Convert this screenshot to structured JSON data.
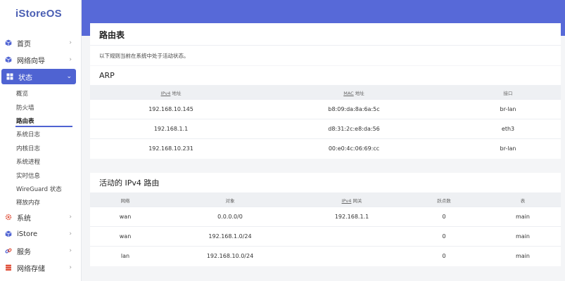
{
  "brand": {
    "logo": "iStoreOS"
  },
  "sidebar": {
    "items": [
      {
        "label": "首页",
        "icon": "cube-icon"
      },
      {
        "label": "网络向导",
        "icon": "cube-icon"
      },
      {
        "label": "状态",
        "icon": "grid-icon"
      },
      {
        "label": "系统",
        "icon": "gear-icon"
      },
      {
        "label": "iStore",
        "icon": "cube-icon"
      },
      {
        "label": "服务",
        "icon": "link-icon"
      },
      {
        "label": "网络存储",
        "icon": "storage-icon"
      }
    ],
    "sub_items": [
      "概览",
      "防火墙",
      "路由表",
      "系统日志",
      "内核日志",
      "系统进程",
      "实时信息",
      "WireGuard 状态",
      "释放内存"
    ]
  },
  "page": {
    "title": "路由表",
    "description": "以下规则当前在系统中处于活动状态。"
  },
  "arp": {
    "heading": "ARP",
    "headers": {
      "ip_prefix": "IPv4",
      "ip_suffix": " 地址",
      "mac_prefix": "MAC",
      "mac_suffix": " 地址",
      "iface": "接口"
    },
    "rows": [
      {
        "ip": "192.168.10.145",
        "mac": "b8:09:da:8a:6a:5c",
        "iface": "br-lan"
      },
      {
        "ip": "192.168.1.1",
        "mac": "d8:31:2c:e8:da:56",
        "iface": "eth3"
      },
      {
        "ip": "192.168.10.231",
        "mac": "00:e0:4c:06:69:cc",
        "iface": "br-lan"
      }
    ]
  },
  "routes": {
    "heading": "活动的 IPv4 路由",
    "headers": {
      "network": "网络",
      "target": "对象",
      "gw_prefix": "IPv4",
      "gw_suffix": " 网关",
      "metric": "跃点数",
      "table": "表"
    },
    "rows": [
      {
        "network": "wan",
        "target": "0.0.0.0/0",
        "gateway": "192.168.1.1",
        "metric": "0",
        "table": "main"
      },
      {
        "network": "wan",
        "target": "192.168.1.0/24",
        "gateway": "",
        "metric": "0",
        "table": "main"
      },
      {
        "network": "lan",
        "target": "192.168.10.0/24",
        "gateway": "",
        "metric": "0",
        "table": "main"
      }
    ]
  },
  "colors": {
    "accent": "#4f63d2",
    "band": "#5769d8",
    "background": "#f4f5f7"
  }
}
